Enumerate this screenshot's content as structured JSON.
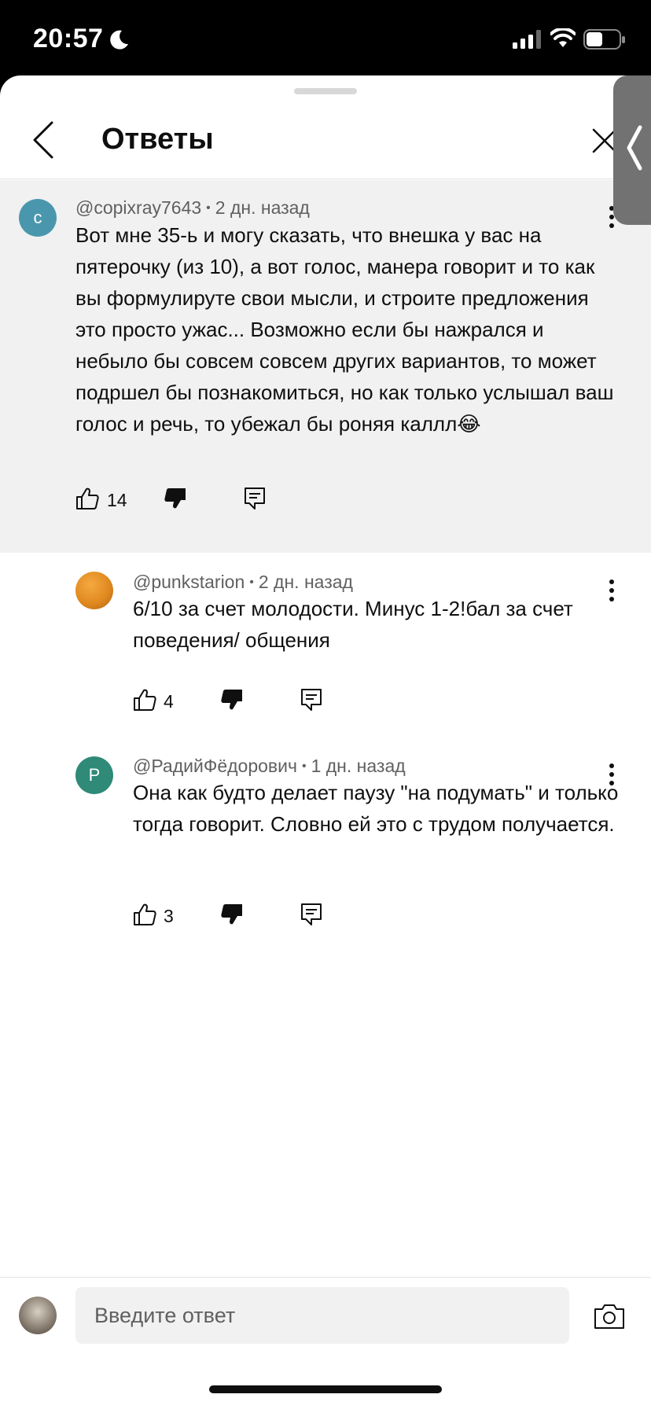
{
  "status_bar": {
    "time": "20:57"
  },
  "header": {
    "title": "Ответы"
  },
  "comments": [
    {
      "avatar_letter": "c",
      "author": "@copixray7643",
      "age": "2 дн. назад",
      "text": "Вот мне 35-ь и могу сказать, что внешка у вас на пятерочку (из 10), а вот голос, манера говорит и то как вы формулируте свои мысли, и строите предложения это просто ужас... Возможно если бы нажрался и небыло бы совсем совсем других вариантов, то может подршел бы познакомиться, но как только услышал ваш голос и речь, то убежал бы роняя каллл😂",
      "likes": "14"
    },
    {
      "author": "@punkstarion",
      "age": "2 дн. назад",
      "text": "6/10 за счет молодости. Минус 1-2!бал за счет поведения/ общения",
      "likes": "4"
    },
    {
      "avatar_letter": "P",
      "author": "@РадийФёдорович",
      "age": "1 дн. назад",
      "text": "Она как будто делает паузу \"на подумать\" и только тогда говорит. Словно ей это с трудом получается.",
      "likes": "3"
    }
  ],
  "reply_box": {
    "placeholder": "Введите ответ"
  },
  "colors": {
    "avatar_c": "#4a97ad",
    "avatar_p": "#2f8a78",
    "parent_bg": "#f1f1f1"
  },
  "icons": [
    "moon-icon",
    "signal-icon",
    "wifi-icon",
    "battery-icon",
    "back-icon",
    "close-icon",
    "chevron-left-icon",
    "more-vert-icon",
    "thumb-up-icon",
    "thumb-down-icon",
    "reply-icon",
    "camera-icon"
  ]
}
